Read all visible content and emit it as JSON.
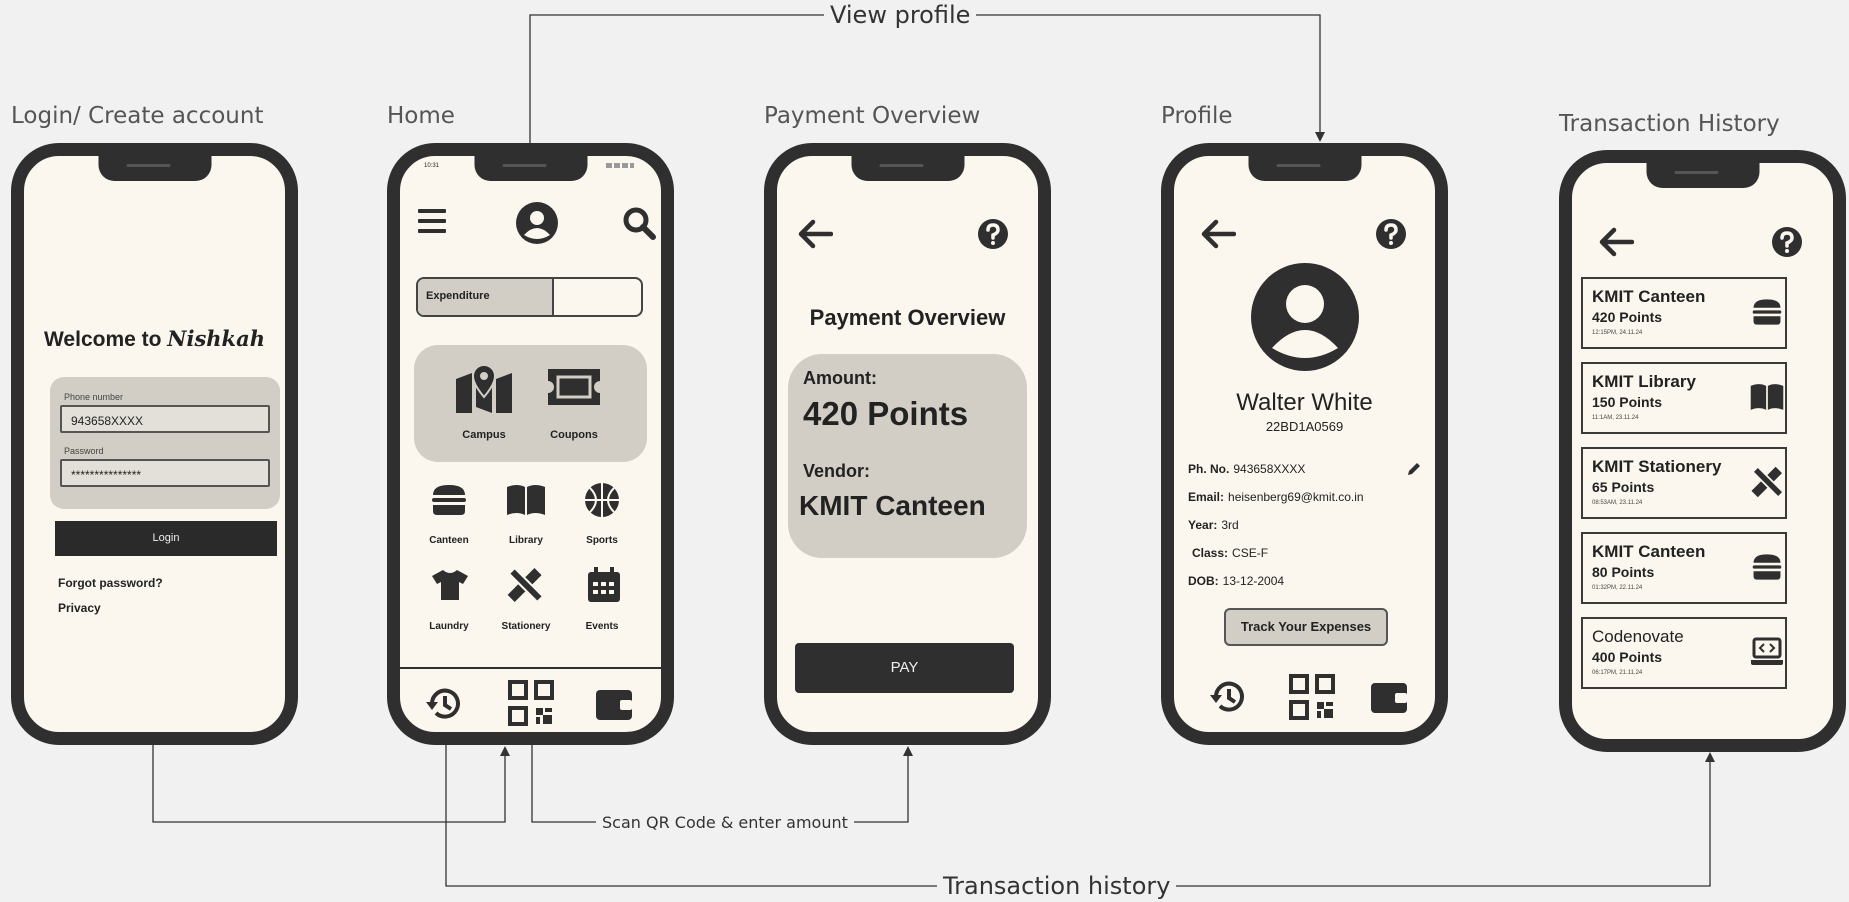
{
  "flow_labels": {
    "view_profile": "View profile",
    "scan_qr": "Scan QR Code & enter amount",
    "transaction_history": "Transaction history"
  },
  "screen_titles": {
    "login": "Login/ Create account",
    "home": "Home",
    "payment": "Payment Overview",
    "profile": "Profile",
    "history": "Transaction History"
  },
  "login": {
    "welcome_prefix": "Welcome to",
    "brand": "Nishkah",
    "phone_label": "Phone number",
    "phone_value": "943658XXXX",
    "password_label": "Password",
    "password_value": "***************",
    "login_button": "Login",
    "forgot_password": "Forgot password?",
    "privacy": "Privacy"
  },
  "home": {
    "status_time": "10:31",
    "expenditure_label": "Expenditure",
    "expenditure_fill": 0.6,
    "featured": [
      {
        "label": "Campus",
        "icon": "map-icon"
      },
      {
        "label": "Coupons",
        "icon": "ticket-icon"
      }
    ],
    "grid": [
      {
        "label": "Canteen",
        "icon": "burger-icon"
      },
      {
        "label": "Library",
        "icon": "book-icon"
      },
      {
        "label": "Sports",
        "icon": "basketball-icon"
      },
      {
        "label": "Laundry",
        "icon": "shirt-icon"
      },
      {
        "label": "Stationery",
        "icon": "pencil-ruler-icon"
      },
      {
        "label": "Events",
        "icon": "calendar-icon"
      }
    ]
  },
  "payment": {
    "heading": "Payment Overview",
    "amount_label": "Amount:",
    "amount_value": "420 Points",
    "vendor_label": "Vendor:",
    "vendor_value": "KMIT Canteen",
    "pay_button": "PAY"
  },
  "profile": {
    "name": "Walter White",
    "roll": "22BD1A0569",
    "fields": [
      {
        "label": "Ph. No.",
        "value": "943658XXXX"
      },
      {
        "label": "Email:",
        "value": "heisenberg69@kmit.co.in"
      },
      {
        "label": "Year:",
        "value": "3rd"
      },
      {
        "label": "Class:",
        "value": "CSE-F"
      },
      {
        "label": "DOB:",
        "value": "13-12-2004"
      }
    ],
    "track_button": "Track Your Expenses"
  },
  "history": {
    "transactions": [
      {
        "vendor": "KMIT Canteen",
        "points": "420 Points",
        "time": "12:15PM, 24.11.24",
        "icon": "burger-icon"
      },
      {
        "vendor": "KMIT Library",
        "points": "150 Points",
        "time": "11:1AM, 23.11.24",
        "icon": "book-icon"
      },
      {
        "vendor": "KMIT Stationery",
        "points": "65 Points",
        "time": "08:53AM, 23.11.24",
        "icon": "pencil-ruler-icon"
      },
      {
        "vendor": "KMIT Canteen",
        "points": "80 Points",
        "time": "01:32PM, 22.11.24",
        "icon": "burger-icon"
      },
      {
        "vendor": "Codenovate",
        "points": "400 Points",
        "time": "06:17PM, 21.11.24",
        "icon": "laptop-code-icon"
      }
    ]
  },
  "colors": {
    "background": "#f1f1f1",
    "phone_frame": "#2f2f2f",
    "screen": "#fbf7ee",
    "panel": "#d2cec6",
    "button_dark": "#2f2f2f"
  }
}
